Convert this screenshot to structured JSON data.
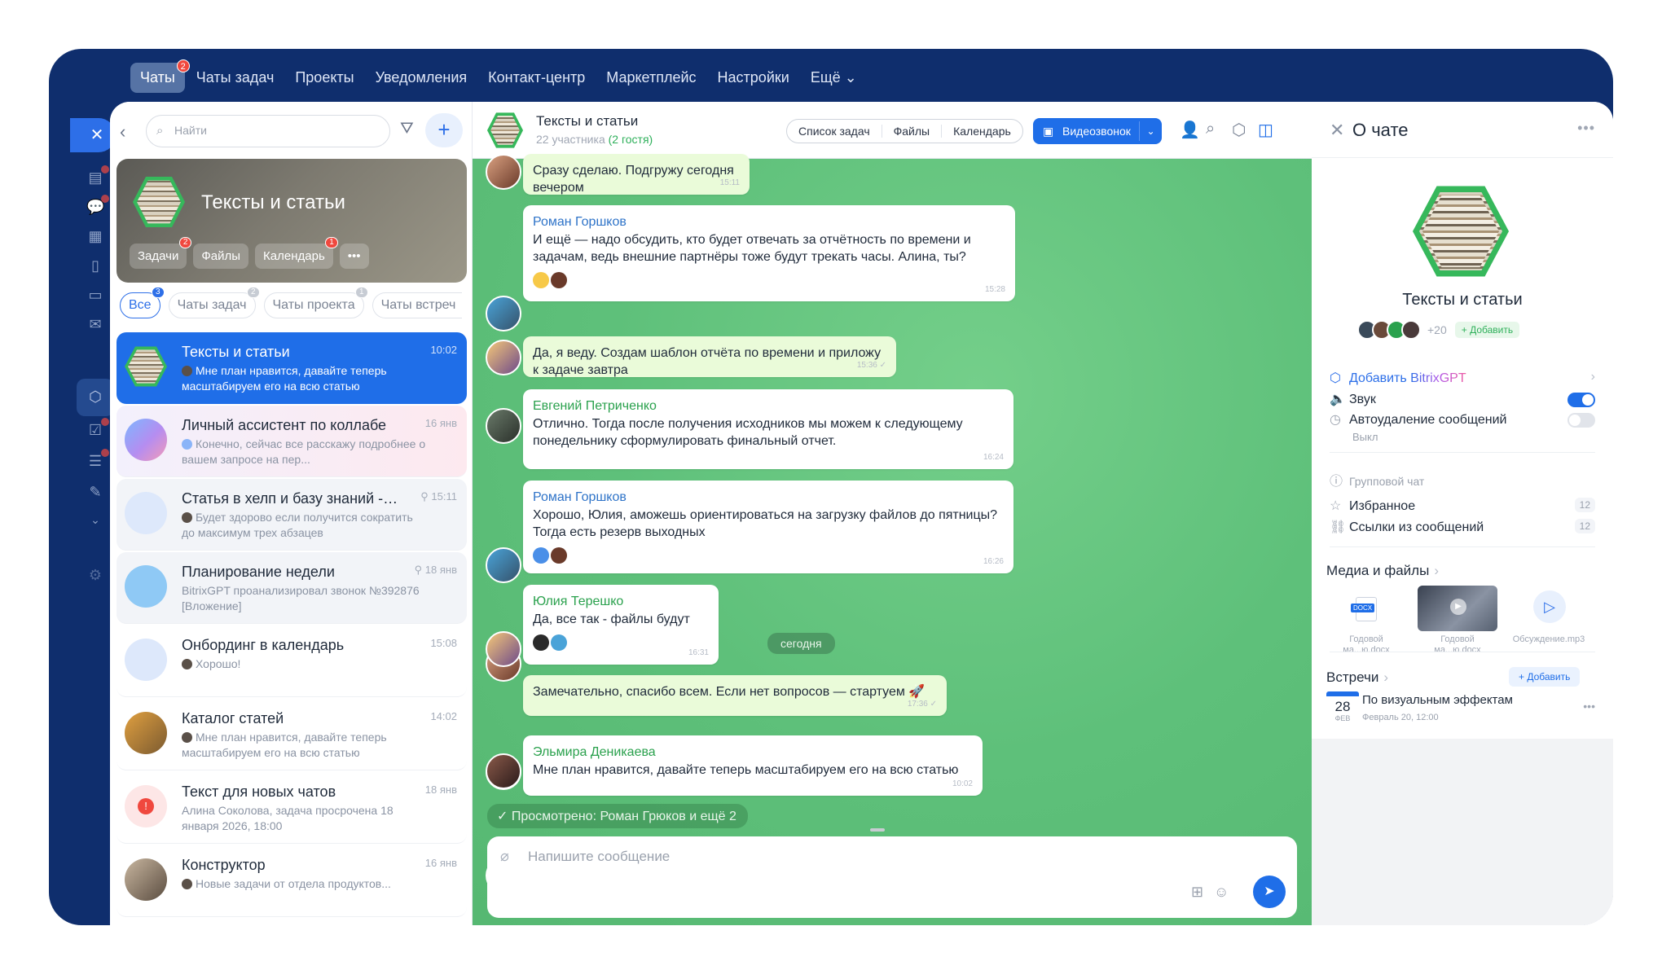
{
  "topnav": {
    "items": [
      {
        "label": "Чаты",
        "badge": "2",
        "active": true
      },
      {
        "label": "Чаты задач"
      },
      {
        "label": "Проекты"
      },
      {
        "label": "Уведомления"
      },
      {
        "label": "Контакт-центр"
      },
      {
        "label": "Маркетплейс"
      },
      {
        "label": "Настройки"
      },
      {
        "label": "Ещё ⌄"
      }
    ]
  },
  "leftbar": {
    "icons": [
      "close-icon",
      "task-list-icon",
      "chat-bubbles-icon",
      "calendar-icon",
      "document-icon",
      "drive-icon",
      "mail-icon",
      "hexagon-icon",
      "checkbox-icon",
      "funnel-icon",
      "pen-icon",
      "chevron-down-icon",
      "settings-icon"
    ]
  },
  "list": {
    "search_placeholder": "Найти",
    "add_label": "+",
    "hero": {
      "title": "Тексты и статьи",
      "chips": [
        {
          "label": "Задачи",
          "badge": "2"
        },
        {
          "label": "Файлы",
          "badge": ""
        },
        {
          "label": "Календарь",
          "badge": "1"
        },
        {
          "label": "•••",
          "badge": ""
        }
      ]
    },
    "filters": [
      {
        "label": "Все",
        "badge": "3",
        "active": true
      },
      {
        "label": "Чаты задач",
        "badge": "2"
      },
      {
        "label": "Чаты проекта",
        "badge": "1"
      },
      {
        "label": "Чаты встреч",
        "badge": ""
      }
    ],
    "chats": [
      {
        "name": "Тексты и статьи",
        "time": "10:02",
        "preview": "Мне план нравится, давайте теперь масштабируем его на всю статью"
      },
      {
        "name": "Личный ассистент по коллабе",
        "time": "16 янв",
        "preview": "Конечно, сейчас все расскажу подробнее о вашем запросе на пер..."
      },
      {
        "name": "Статья в хелп и базу знаний - п...",
        "time": "15:11",
        "preview": "Будет здорово если получится сократить до максимум трех абзацев"
      },
      {
        "name": "Планирование недели",
        "time": "18 янв",
        "preview": "BitrixGPT проанализировал звонок №392876 [Вложение]"
      },
      {
        "name": "Онбординг в календарь",
        "time": "15:08",
        "preview": "Хорошо!"
      },
      {
        "name": "Каталог статей",
        "time": "14:02",
        "preview": "Мне план нравится, давайте теперь масштабируем его на всю статью"
      },
      {
        "name": "Текст для новых чатов",
        "time": "18 янв",
        "preview": "Алина Соколова, задача просрочена 18 января 2026, 18:00"
      },
      {
        "name": "Конструктор",
        "time": "16 янв",
        "preview": "Новые задачи от отдела продуктов..."
      }
    ]
  },
  "chat": {
    "title": "Тексты и статьи",
    "participants": "22 участника",
    "guests": "(2 гостя)",
    "tabs": [
      "Список задач",
      "Файлы",
      "Календарь"
    ],
    "video_label": "Видеозвонок",
    "messages": [
      {
        "author": "",
        "text": "Сразу сделаю. Подгружу сегодня вечером",
        "time": "15:11"
      },
      {
        "author": "Роман Горшков",
        "text": "И ещё — надо обсудить, кто будет отвечать за отчётность по времени и задачам, ведь внешние партнёры тоже будут трекать часы. Алина, ты?",
        "time": "15:28"
      },
      {
        "author": "",
        "text": "Да, я веду. Создам шаблон отчёта по времени и приложу к задаче завтра",
        "time": "15:36 ✓"
      },
      {
        "author": "Евгений Петриченко",
        "text": "Отлично. Тогда после получения исходников мы можем к следующему понедельнику сформулировать финальный отчет.",
        "time": "16:24"
      },
      {
        "author": "Роман Горшков",
        "text": "Хорошо, Юлия, аможешь ориентироваться на загрузку файлов до пятницы? Тогда есть резерв выходных",
        "time": "16:26"
      },
      {
        "author": "Юлия Терешко",
        "text": "Да, все так - файлы будут",
        "time": "16:31"
      },
      {
        "author": "",
        "text": "Замечательно, спасибо всем. Если нет вопросов — стартуем 🚀",
        "time": "17:36 ✓"
      },
      {
        "author": "Эльмира Деникаева",
        "text": "Мне план нравится, давайте теперь масштабируем его на всю статью",
        "time": "10:02"
      }
    ],
    "date_divider": "сегодня",
    "seen": "Просмотрено: Роман Грюков и ещё 2",
    "composer_placeholder": "Напишите сообщение",
    "colors": {
      "accent": "#1f6ee8",
      "chat_bg": "#5ec07a",
      "guest": "#2fb05b"
    }
  },
  "side": {
    "title": "О чате",
    "chat_name": "Тексты и статьи",
    "member_extra": "+20",
    "add_member": "+ Добавить",
    "add_gpt_prefix": "Добавить ",
    "add_gpt_brand": "BitrixGPT",
    "sound": "Звук",
    "autodelete": "Автоудаление сообщений",
    "autodelete_value": "Выкл",
    "group_chat": "Групповой чат",
    "favorites": "Избранное",
    "favorites_count": "12",
    "links": "Ссылки из сообщений",
    "links_count": "12",
    "media_title": "Медиа и файлы",
    "media": [
      {
        "caption": "Годовой ма...ю.docx",
        "kind": "docx",
        "badge": "DOCX"
      },
      {
        "caption": "Годовой ма...ю.docx",
        "kind": "video"
      },
      {
        "caption": "Обсуждение.mp3",
        "kind": "audio"
      }
    ],
    "meetings_title": "Встречи",
    "meetings_add": "+ Добавить",
    "meeting": {
      "day": "28",
      "month": "ФЕВ",
      "title": "По визуальным эффектам",
      "date": "Февраль 20, 12:00"
    }
  }
}
